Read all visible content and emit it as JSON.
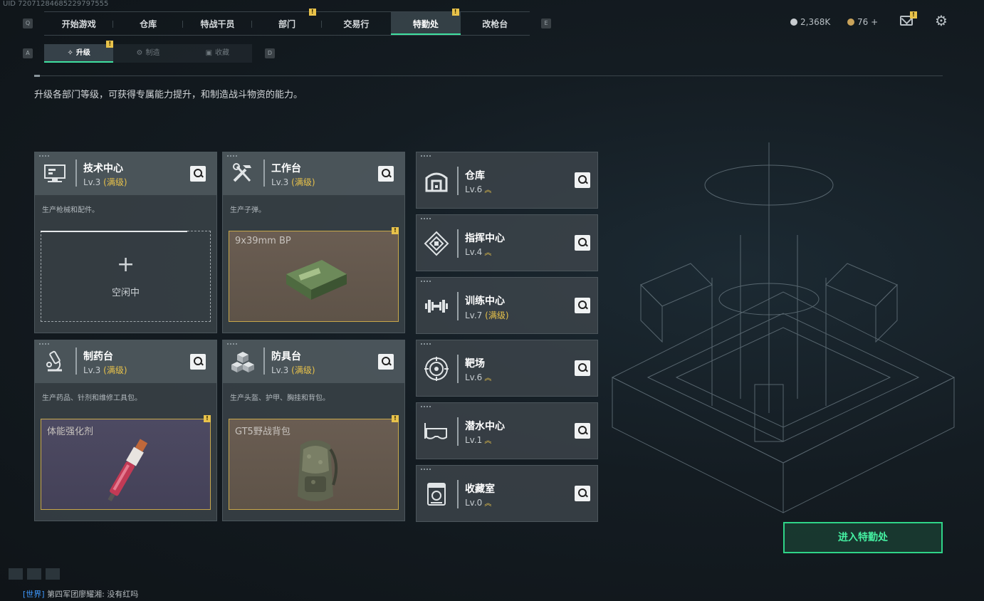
{
  "uid": "UID 72071284685229797555",
  "keys": {
    "q": "Q",
    "e": "E",
    "a": "A",
    "d": "D"
  },
  "topnav": {
    "tabs": [
      {
        "label": "开始游戏"
      },
      {
        "label": "仓库"
      },
      {
        "label": "特战干员"
      },
      {
        "label": "部门",
        "badge": "!"
      },
      {
        "label": "交易行"
      },
      {
        "label": "特勤处",
        "badge": "!"
      },
      {
        "label": "改枪台"
      }
    ]
  },
  "resources": {
    "silver": "2,368K",
    "gold": "76 +"
  },
  "mail_badge": "!",
  "subnav": {
    "tabs": [
      {
        "label": "升级",
        "badge": "!"
      },
      {
        "label": "制造"
      },
      {
        "label": "收藏"
      }
    ]
  },
  "description": "升级各部门等级，可获得专属能力提升，和制造战斗物资的能力。",
  "cards": [
    {
      "name": "技术中心",
      "level": "Lv.3",
      "max": "(满级)",
      "sub": "生产枪械和配件。",
      "slot": {
        "plus": "+",
        "status": "空闲中"
      }
    },
    {
      "name": "工作台",
      "level": "Lv.3",
      "max": "(满级)",
      "sub": "生产子弹。",
      "slot": {
        "item": "9x39mm BP",
        "badge": "!"
      }
    },
    {
      "name": "制药台",
      "level": "Lv.3",
      "max": "(满级)",
      "sub": "生产药品、针剂和维修工具包。",
      "slot": {
        "item": "体能强化剂",
        "badge": "!"
      }
    },
    {
      "name": "防具台",
      "level": "Lv.3",
      "max": "(满级)",
      "sub": "生产头盔、护甲、胸挂和背包。",
      "slot": {
        "item": "GT5野战背包",
        "badge": "!"
      }
    }
  ],
  "departments": [
    {
      "name": "仓库",
      "level": "Lv.6",
      "max": ""
    },
    {
      "name": "指挥中心",
      "level": "Lv.4",
      "max": ""
    },
    {
      "name": "训练中心",
      "level": "Lv.7",
      "max": "(满级)"
    },
    {
      "name": "靶场",
      "level": "Lv.6",
      "max": ""
    },
    {
      "name": "潜水中心",
      "level": "Lv.1",
      "max": ""
    },
    {
      "name": "收藏室",
      "level": "Lv.0",
      "max": ""
    }
  ],
  "enter_button": "进入特勤处",
  "chat": {
    "channel": "[世界]",
    "sender": "第四军团廖耀湘:",
    "message": "没有红吗"
  },
  "colors": {
    "accent": "#3fe0a0",
    "badge": "#e8c24a",
    "enter": "#45f0a2"
  }
}
